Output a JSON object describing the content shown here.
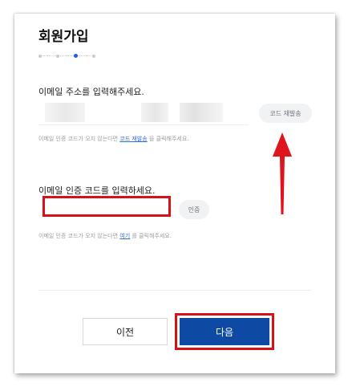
{
  "title": "회원가입",
  "stepper": {
    "total_steps": 4,
    "current_step": 3
  },
  "email_section": {
    "label": "이메일 주소를 입력해주세요.",
    "resend_button": "코드 재발송",
    "hint_prefix": "이메일 인증 코드가 오지 않는다면",
    "hint_link": "코드 재발송",
    "hint_suffix": "을 클릭해주세요."
  },
  "code_section": {
    "label": "이메일 인증 코드를 입력하세요.",
    "verify_button": "인증",
    "hint_prefix": "이메일 인증 코드가 오지 않는다면",
    "hint_link": "여기",
    "hint_suffix": "를 클릭해주세요."
  },
  "buttons": {
    "prev": "이전",
    "next": "다음"
  },
  "colors": {
    "primary": "#0e4aa3",
    "highlight": "#d7101a",
    "link": "#2d6fdc",
    "step_active": "#1e5ee8"
  }
}
